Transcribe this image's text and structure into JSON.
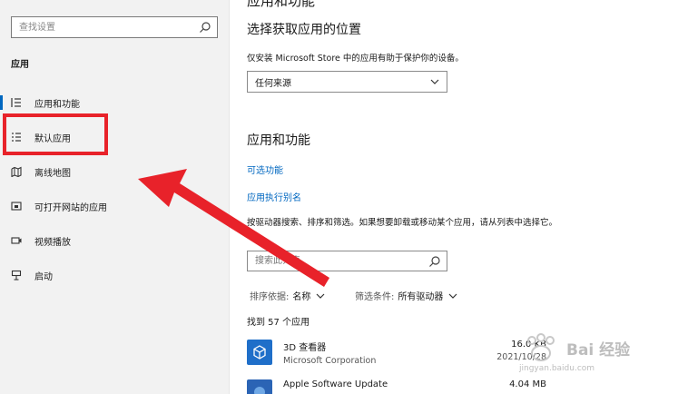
{
  "sidebar": {
    "search_placeholder": "查找设置",
    "section_label": "应用",
    "items": [
      {
        "label": "应用和功能",
        "icon": "list-icon"
      },
      {
        "label": "默认应用",
        "icon": "default-apps-icon"
      },
      {
        "label": "离线地图",
        "icon": "map-icon"
      },
      {
        "label": "可打开网站的应用",
        "icon": "open-website-icon"
      },
      {
        "label": "视频播放",
        "icon": "video-icon"
      },
      {
        "label": "启动",
        "icon": "startup-icon"
      }
    ]
  },
  "main": {
    "page_title_partial": "应用和功能",
    "source_section": {
      "heading": "选择获取应用的位置",
      "description": "仅安装 Microsoft Store 中的应用有助于保护你的设备。",
      "dropdown_value": "任何来源"
    },
    "apps_section": {
      "heading": "应用和功能",
      "link_optional_features": "可选功能",
      "link_aliases": "应用执行别名",
      "description": "按驱动器搜索、排序和筛选。如果想要卸载或移动某个应用，请从列表中选择它。",
      "search_placeholder": "搜索此列表",
      "sort_label": "排序依据:",
      "sort_value": "名称",
      "filter_label": "筛选条件:",
      "filter_value": "所有驱动器",
      "found_text": "找到 57 个应用",
      "apps": [
        {
          "name": "3D 查看器",
          "publisher": "Microsoft Corporation",
          "size": "16.0 KB",
          "date": "2021/10/28"
        },
        {
          "name": "Apple Software Update",
          "publisher": "",
          "size": "4.04 MB",
          "date": ""
        }
      ]
    }
  },
  "watermark": {
    "text": "Bai 经验",
    "url": "jingyan.baidu.com"
  },
  "colors": {
    "accent": "#0067c0",
    "highlight": "#e8222a",
    "sidebar_bg": "#f2f2f2"
  }
}
